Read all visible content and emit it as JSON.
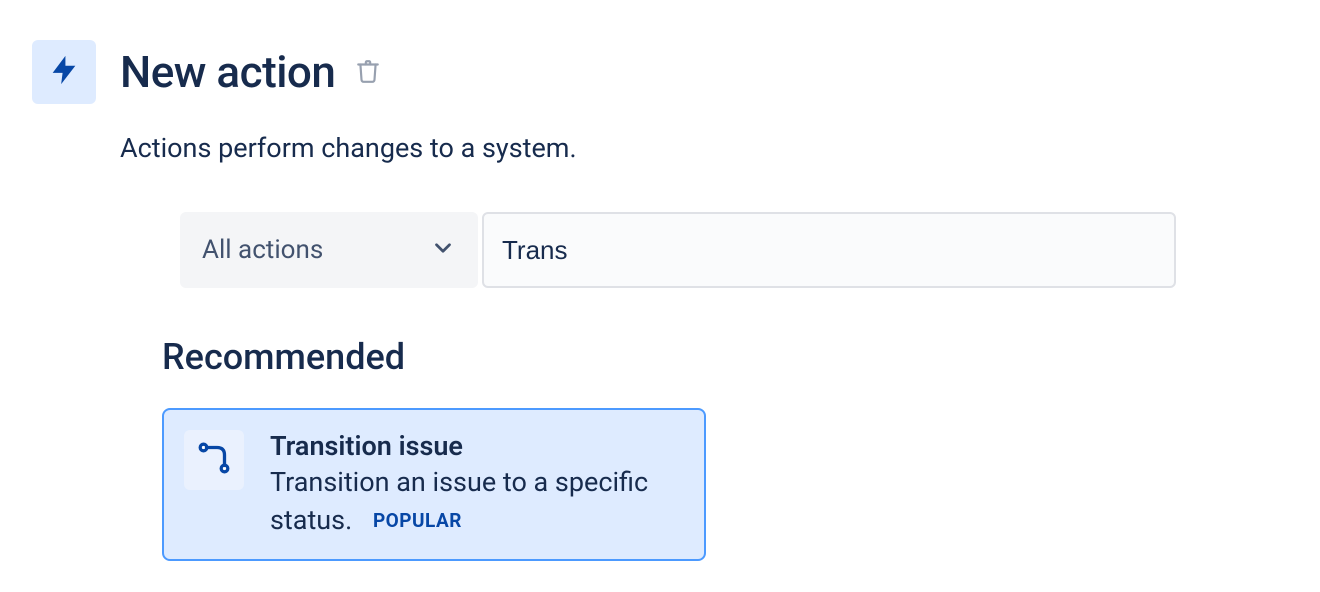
{
  "header": {
    "title": "New action",
    "subtitle": "Actions perform changes to a system."
  },
  "controls": {
    "dropdown_label": "All actions",
    "search_value": "Trans"
  },
  "section": {
    "heading": "Recommended"
  },
  "card": {
    "title": "Transition issue",
    "description": "Transition an issue to a specific status.",
    "badge": "POPULAR"
  }
}
